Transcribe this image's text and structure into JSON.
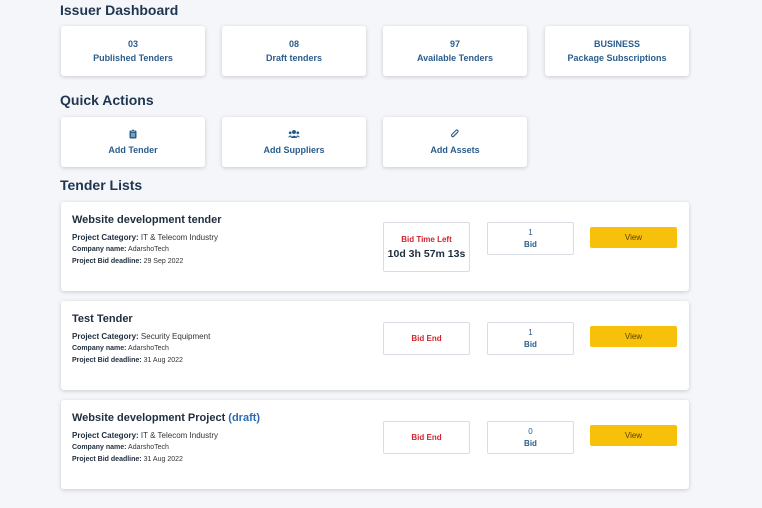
{
  "dashboard": {
    "title": "Issuer Dashboard",
    "stats": [
      {
        "value": "03",
        "label": "Published Tenders"
      },
      {
        "value": "08",
        "label": "Draft tenders"
      },
      {
        "value": "97",
        "label": "Available Tenders"
      },
      {
        "value": "BUSINESS",
        "label": "Package Subscriptions"
      }
    ]
  },
  "quick_actions": {
    "title": "Quick Actions",
    "items": [
      {
        "label": "Add Tender",
        "icon": "clipboard-icon"
      },
      {
        "label": "Add Suppliers",
        "icon": "users-icon"
      },
      {
        "label": "Add Assets",
        "icon": "paperclip-icon"
      }
    ]
  },
  "tender_lists": {
    "title": "Tender Lists",
    "category_label": "Project Category:",
    "company_label": "Company name:",
    "deadline_label": "Project Bid deadline:",
    "bid_label": "Bid",
    "view_label": "View",
    "items": [
      {
        "title": "Website development tender",
        "draft": "",
        "category": "IT & Telecom Industry",
        "company": "AdarshoTech",
        "deadline": "29 Sep 2022",
        "status": "Bid Time Left",
        "timer": "10d 3h 57m 13s",
        "bids": "1"
      },
      {
        "title": "Test Tender",
        "draft": "",
        "category": "Security Equipment",
        "company": "AdarshoTech",
        "deadline": "31 Aug 2022",
        "status": "Bid End",
        "timer": "",
        "bids": "1"
      },
      {
        "title": "Website development Project",
        "draft": "(draft)",
        "category": "IT & Telecom Industry",
        "company": "AdarshoTech",
        "deadline": "31 Aug 2022",
        "status": "Bid End",
        "timer": "",
        "bids": "0"
      }
    ]
  },
  "colors": {
    "accent": "#2b5d8c",
    "danger": "#d0242f",
    "button": "#f7c00a"
  }
}
